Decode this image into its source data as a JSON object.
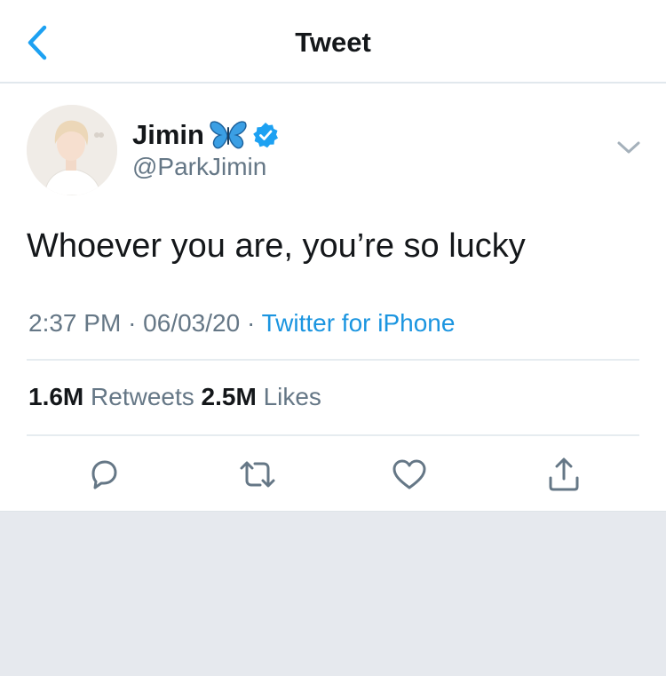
{
  "nav": {
    "title": "Tweet",
    "back_icon": "chevron-left-icon"
  },
  "tweet": {
    "author": {
      "display_name": "Jimin",
      "name_emoji": "butterfly-icon",
      "verified": true,
      "handle": "@ParkJimin"
    },
    "text": "Whoever you are, you’re so lucky",
    "time": "2:37 PM",
    "separator": "·",
    "date": "06/03/20",
    "source": "Twitter for iPhone",
    "stats": {
      "retweets_count": "1.6M",
      "retweets_label": "Retweets",
      "likes_count": "2.5M",
      "likes_label": "Likes"
    },
    "actions": [
      "reply-icon",
      "retweet-icon",
      "like-icon",
      "share-icon"
    ]
  },
  "colors": {
    "accent": "#1da1f2",
    "link": "#1b95e0",
    "secondary_text": "#657786",
    "background": "#e6e9ee",
    "verified": "#1da1f2"
  }
}
